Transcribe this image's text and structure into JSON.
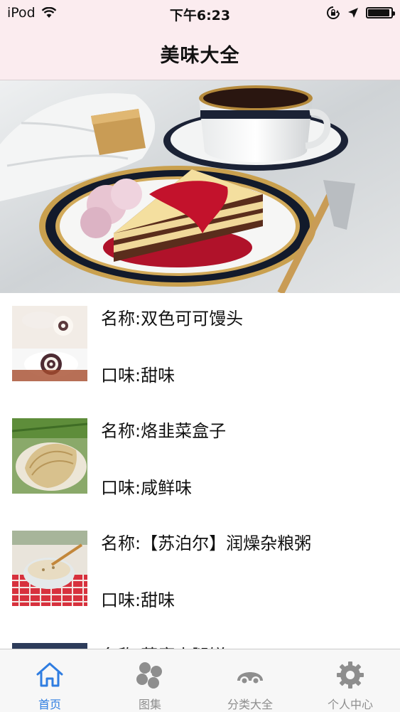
{
  "status_bar": {
    "carrier": "iPod",
    "time": "下午6:23",
    "battery_level": 0.95
  },
  "nav": {
    "title": "美味大全"
  },
  "banner": {
    "page_count": 4,
    "current_page": 1
  },
  "list": {
    "items": [
      {
        "name": "名称:双色可可馒头",
        "taste": "口味:甜味"
      },
      {
        "name": "名称:烙韭菜盒子",
        "taste": "口味:咸鲜味"
      },
      {
        "name": "名称:【苏泊尔】润燥杂粮粥",
        "taste": "口味:甜味"
      },
      {
        "name": "名称:蒸腐火腿饼",
        "taste": ""
      }
    ]
  },
  "tab_bar": {
    "tabs": [
      {
        "label": "首页",
        "icon": "home-icon",
        "active": true
      },
      {
        "label": "图集",
        "icon": "pinwheel-icon",
        "active": false
      },
      {
        "label": "分类大全",
        "icon": "category-icon",
        "active": false
      },
      {
        "label": "个人中心",
        "icon": "gear-icon",
        "active": false
      }
    ]
  },
  "colors": {
    "header_bg": "#fbecef",
    "tab_active": "#2f7de1",
    "tab_inactive": "#8e8e8e"
  }
}
